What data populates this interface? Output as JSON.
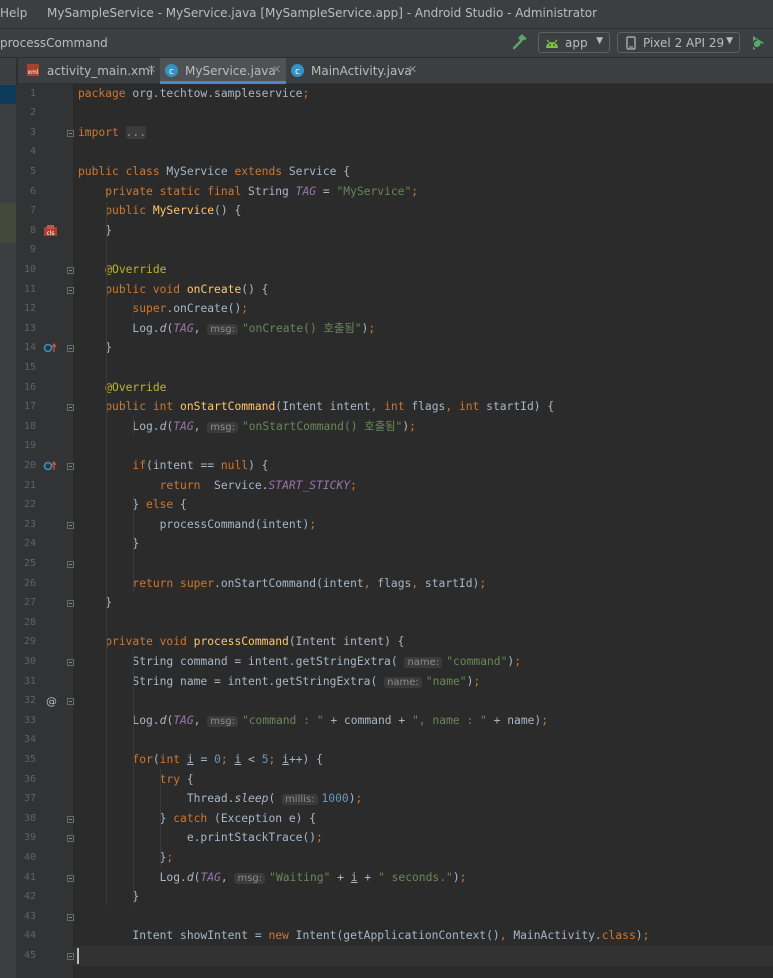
{
  "titlebar": {
    "menu_fragment": "Help",
    "title": "MySampleService - MyService.java [MySampleService.app] - Android Studio - Administrator"
  },
  "navbar": {
    "breadcrumb": "processCommand",
    "run_config": "app",
    "device": "Pixel 2 API 29",
    "icons": [
      "hammer-icon",
      "android-icon",
      "phone-icon",
      "run-icon",
      "dropdown-arrow-icon"
    ]
  },
  "tabs": [
    {
      "label": "activity_main.xml",
      "icon": "xml-file-icon",
      "active": false
    },
    {
      "label": "MyService.java",
      "icon": "class-file-icon",
      "active": true
    },
    {
      "label": "MainActivity.java",
      "icon": "class-file-icon",
      "active": false
    }
  ],
  "colors": {
    "keyword": "#cc7832",
    "string": "#6a8759",
    "annotation": "#bbb529",
    "method_decl": "#ffc66d",
    "field": "#9876aa",
    "number": "#6897bb",
    "plain": "#a9b7c6",
    "tab_underline": "#4a88c7"
  },
  "editor": {
    "current_line": 48,
    "lines": [
      [
        {
          "t": "package",
          "c": "kw"
        },
        {
          "t": " org.techtow.sampleservice"
        },
        {
          "t": ";",
          "c": "kw"
        }
      ],
      [],
      [
        {
          "t": "import ",
          "c": "kw"
        },
        {
          "t": "...",
          "c": "fbox"
        }
      ],
      [],
      [
        {
          "t": "public class ",
          "c": "kw"
        },
        {
          "t": "MyService "
        },
        {
          "t": "extends ",
          "c": "kw"
        },
        {
          "t": "Service {"
        }
      ],
      [
        {
          "t": "    "
        },
        {
          "t": "private static final ",
          "c": "kw"
        },
        {
          "t": "String "
        },
        {
          "t": "TAG",
          "c": "fld it"
        },
        {
          "t": " = "
        },
        {
          "t": "\"MyService\"",
          "c": "str"
        },
        {
          "t": ";",
          "c": "kw"
        }
      ],
      [
        {
          "t": "    "
        },
        {
          "t": "public ",
          "c": "kw"
        },
        {
          "t": "MyService",
          "c": "fn"
        },
        {
          "t": "() {"
        }
      ],
      [
        {
          "t": "    }"
        }
      ],
      [],
      [
        {
          "t": "    "
        },
        {
          "t": "@Override",
          "c": "ann"
        }
      ],
      [
        {
          "t": "    "
        },
        {
          "t": "public void ",
          "c": "kw"
        },
        {
          "t": "onCreate",
          "c": "fn"
        },
        {
          "t": "() {"
        }
      ],
      [
        {
          "t": "        "
        },
        {
          "t": "super",
          "c": "kw"
        },
        {
          "t": ".onCreate()"
        },
        {
          "t": ";",
          "c": "kw"
        }
      ],
      [
        {
          "t": "        Log."
        },
        {
          "t": "d",
          "c": "it"
        },
        {
          "t": "("
        },
        {
          "t": "TAG",
          "c": "fld it"
        },
        {
          "t": ", "
        },
        {
          "t": "msg:",
          "c": "hint"
        },
        {
          "t": "\"onCreate() 호출됨\"",
          "c": "str"
        },
        {
          "t": ")"
        },
        {
          "t": ";",
          "c": "kw"
        }
      ],
      [
        {
          "t": "    }"
        }
      ],
      [],
      [
        {
          "t": "    "
        },
        {
          "t": "@Override",
          "c": "ann"
        }
      ],
      [
        {
          "t": "    "
        },
        {
          "t": "public int ",
          "c": "kw"
        },
        {
          "t": "onStartCommand",
          "c": "fn"
        },
        {
          "t": "(Intent intent"
        },
        {
          "t": ", ",
          "c": "kw"
        },
        {
          "t": "int ",
          "c": "kw"
        },
        {
          "t": "flags"
        },
        {
          "t": ", ",
          "c": "kw"
        },
        {
          "t": "int ",
          "c": "kw"
        },
        {
          "t": "startId) {"
        }
      ],
      [
        {
          "t": "        Log."
        },
        {
          "t": "d",
          "c": "it"
        },
        {
          "t": "("
        },
        {
          "t": "TAG",
          "c": "fld it"
        },
        {
          "t": ", "
        },
        {
          "t": "msg:",
          "c": "hint"
        },
        {
          "t": "\"onStartCommand() 호출됨\"",
          "c": "str"
        },
        {
          "t": ")"
        },
        {
          "t": ";",
          "c": "kw"
        }
      ],
      [],
      [
        {
          "t": "        "
        },
        {
          "t": "if",
          "c": "kw"
        },
        {
          "t": "(intent == "
        },
        {
          "t": "null",
          "c": "kw"
        },
        {
          "t": ") {"
        }
      ],
      [
        {
          "t": "            "
        },
        {
          "t": "return  ",
          "c": "kw"
        },
        {
          "t": "Service."
        },
        {
          "t": "START_STICKY",
          "c": "fld it"
        },
        {
          "t": ";",
          "c": "kw"
        }
      ],
      [
        {
          "t": "        } "
        },
        {
          "t": "else ",
          "c": "kw"
        },
        {
          "t": "{"
        }
      ],
      [
        {
          "t": "            processCommand(intent)"
        },
        {
          "t": ";",
          "c": "kw"
        }
      ],
      [
        {
          "t": "        }"
        }
      ],
      [],
      [
        {
          "t": "        "
        },
        {
          "t": "return super",
          "c": "kw"
        },
        {
          "t": ".onStartCommand(intent"
        },
        {
          "t": ", ",
          "c": "kw"
        },
        {
          "t": "flags"
        },
        {
          "t": ", ",
          "c": "kw"
        },
        {
          "t": "startId)"
        },
        {
          "t": ";",
          "c": "kw"
        }
      ],
      [
        {
          "t": "    }"
        }
      ],
      [],
      [
        {
          "t": "    "
        },
        {
          "t": "private void ",
          "c": "kw"
        },
        {
          "t": "processCommand",
          "c": "fn"
        },
        {
          "t": "(Intent intent) {"
        }
      ],
      [
        {
          "t": "        String command = intent.getStringExtra( "
        },
        {
          "t": "name:",
          "c": "hint"
        },
        {
          "t": "\"command\"",
          "c": "str"
        },
        {
          "t": ")"
        },
        {
          "t": ";",
          "c": "kw"
        }
      ],
      [
        {
          "t": "        String name = intent.getStringExtra( "
        },
        {
          "t": "name:",
          "c": "hint"
        },
        {
          "t": "\"name\"",
          "c": "str"
        },
        {
          "t": ")"
        },
        {
          "t": ";",
          "c": "kw"
        }
      ],
      [],
      [
        {
          "t": "        Log."
        },
        {
          "t": "d",
          "c": "it"
        },
        {
          "t": "("
        },
        {
          "t": "TAG",
          "c": "fld it"
        },
        {
          "t": ", "
        },
        {
          "t": "msg:",
          "c": "hint"
        },
        {
          "t": "\"command : \"",
          "c": "str"
        },
        {
          "t": " + command + "
        },
        {
          "t": "\", name : \"",
          "c": "str"
        },
        {
          "t": " + name)"
        },
        {
          "t": ";",
          "c": "kw"
        }
      ],
      [],
      [
        {
          "t": "        "
        },
        {
          "t": "for",
          "c": "kw"
        },
        {
          "t": "("
        },
        {
          "t": "int ",
          "c": "kw"
        },
        {
          "t": "i",
          "c": "ul"
        },
        {
          "t": " = "
        },
        {
          "t": "0",
          "c": "num"
        },
        {
          "t": "; ",
          "c": "kw"
        },
        {
          "t": "i",
          "c": "ul"
        },
        {
          "t": " < "
        },
        {
          "t": "5",
          "c": "num"
        },
        {
          "t": "; ",
          "c": "kw"
        },
        {
          "t": "i",
          "c": "ul"
        },
        {
          "t": "++) {"
        }
      ],
      [
        {
          "t": "            "
        },
        {
          "t": "try ",
          "c": "kw"
        },
        {
          "t": "{"
        }
      ],
      [
        {
          "t": "                Thread."
        },
        {
          "t": "sleep",
          "c": "it"
        },
        {
          "t": "( "
        },
        {
          "t": "millis:",
          "c": "hint"
        },
        {
          "t": "1000",
          "c": "num"
        },
        {
          "t": ")"
        },
        {
          "t": ";",
          "c": "kw"
        }
      ],
      [
        {
          "t": "            } "
        },
        {
          "t": "catch ",
          "c": "kw"
        },
        {
          "t": "(Exception e) {"
        }
      ],
      [
        {
          "t": "                e.printStackTrace()"
        },
        {
          "t": ";",
          "c": "kw"
        }
      ],
      [
        {
          "t": "            }"
        },
        {
          "t": ";",
          "c": "kw"
        }
      ],
      [
        {
          "t": "            Log."
        },
        {
          "t": "d",
          "c": "it"
        },
        {
          "t": "("
        },
        {
          "t": "TAG",
          "c": "fld it"
        },
        {
          "t": ", "
        },
        {
          "t": "msg:",
          "c": "hint"
        },
        {
          "t": "\"Waiting\"",
          "c": "str"
        },
        {
          "t": " + "
        },
        {
          "t": "i",
          "c": "ul"
        },
        {
          "t": " + "
        },
        {
          "t": "\" seconds.\"",
          "c": "str"
        },
        {
          "t": ")"
        },
        {
          "t": ";",
          "c": "kw"
        }
      ],
      [
        {
          "t": "        }"
        }
      ],
      [],
      [
        {
          "t": "        Intent showIntent = "
        },
        {
          "t": "new ",
          "c": "kw"
        },
        {
          "t": "Intent(getApplicationContext()"
        },
        {
          "t": ", ",
          "c": "kw"
        },
        {
          "t": "MainActivity."
        },
        {
          "t": "class",
          "c": "kw"
        },
        {
          "t": ")"
        },
        {
          "t": ";",
          "c": "kw"
        }
      ],
      []
    ],
    "gutter_icons": [
      {
        "line": 8,
        "icon": "class-icon"
      },
      {
        "line": 14,
        "icon": "override-icon"
      },
      {
        "line": 20,
        "icon": "override-icon"
      },
      {
        "line": 32,
        "icon": "at-icon"
      }
    ],
    "fold_lines": [
      3,
      10,
      11,
      14,
      17,
      20,
      23,
      25,
      27,
      30,
      32,
      38,
      39,
      41,
      43,
      45
    ]
  }
}
